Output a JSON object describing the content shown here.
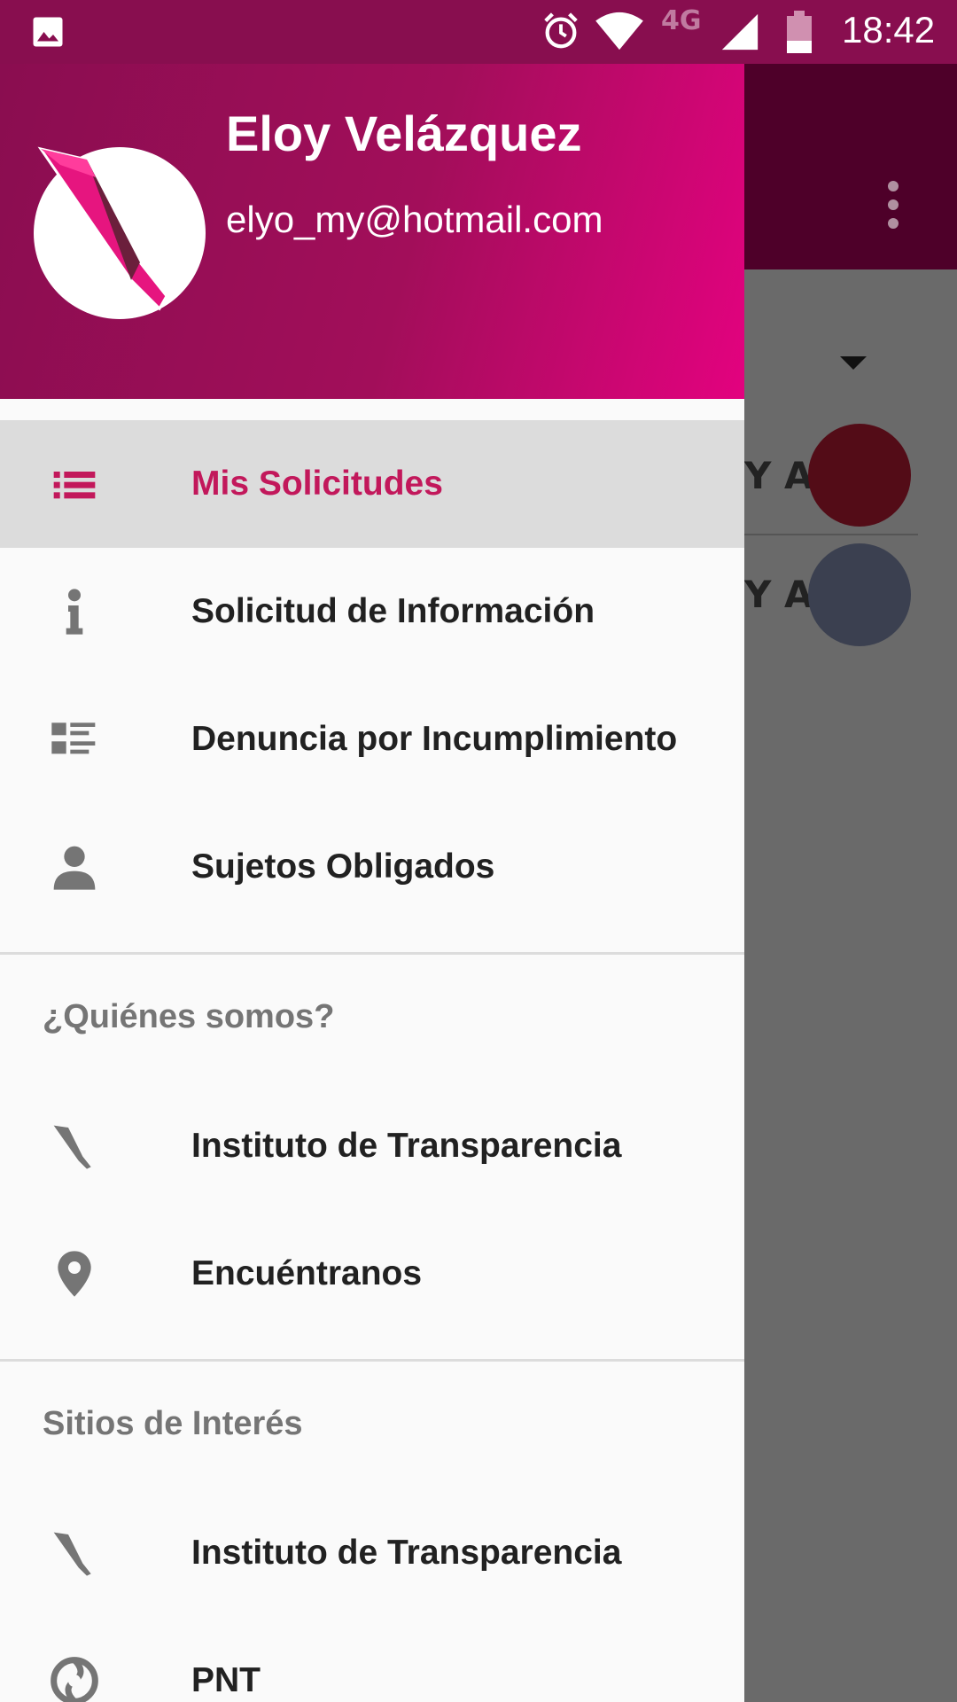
{
  "status_bar": {
    "network_label": "4G",
    "time": "18:42",
    "icons": [
      "gallery-icon",
      "alarm-icon",
      "wifi-icon",
      "signal-icon",
      "battery-icon"
    ]
  },
  "background_app": {
    "row1_text": "Y A",
    "row2_text": "Y A",
    "avatar_colors": [
      "#530c17",
      "#3b4050"
    ]
  },
  "drawer": {
    "header": {
      "user_name": "Eloy Velázquez",
      "user_email": "elyo_my@hotmail.com",
      "gradient_colors": [
        "#8a0d50",
        "#e3027f"
      ]
    },
    "main_items": [
      {
        "label": "Mis Solicitudes",
        "icon": "list-icon",
        "active": true
      },
      {
        "label": "Solicitud de Información",
        "icon": "info-icon",
        "active": false
      },
      {
        "label": "Denuncia por Incumplimiento",
        "icon": "report-list-icon",
        "active": false
      },
      {
        "label": "Sujetos Obligados",
        "icon": "person-icon",
        "active": false
      }
    ],
    "sections": [
      {
        "title": "¿Quiénes somos?",
        "items": [
          {
            "label": "Instituto de Transparencia",
            "icon": "institute-logo-icon"
          },
          {
            "label": "Encuéntranos",
            "icon": "location-pin-icon"
          }
        ]
      },
      {
        "title": "Sitios de Interés",
        "items": [
          {
            "label": "Instituto de Transparencia",
            "icon": "institute-logo-icon"
          },
          {
            "label": "PNT",
            "icon": "pnt-logo-icon"
          }
        ]
      }
    ],
    "accent_color": "#c2185b"
  }
}
